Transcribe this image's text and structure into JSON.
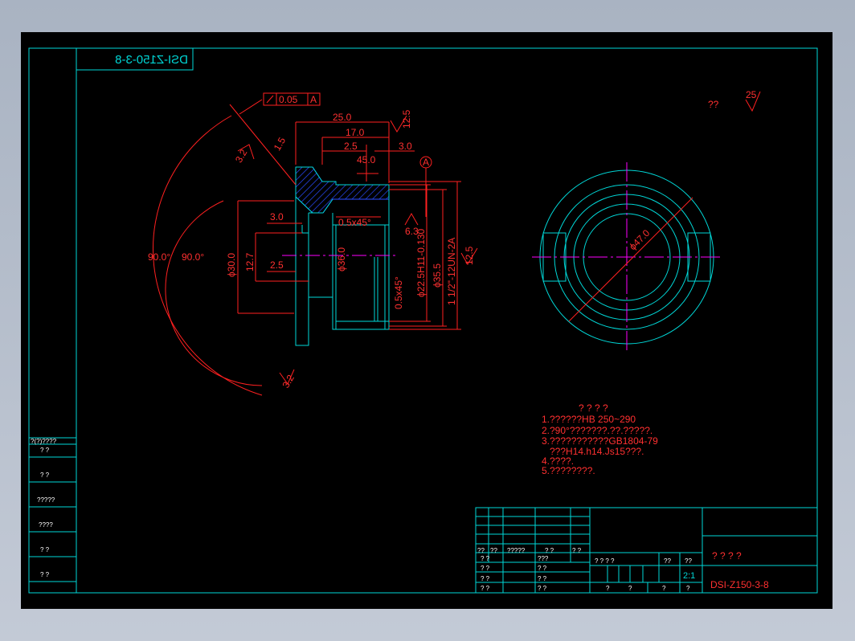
{
  "drawing": {
    "code_mirrored": "DSI-Z150-3-8",
    "code": "DSI-Z150-3-8",
    "scale": "2:1",
    "title_marks": "? ? ? ?",
    "roughness_note": "??",
    "roughness_value": "25"
  },
  "dimensions": {
    "tol_value": "0.05",
    "tol_datum": "A",
    "datum_label": "A",
    "d_25": "25.0",
    "d_17": "17.0",
    "d_2_5_top": "2.5",
    "d_3_0_top": "3.0",
    "d_45": "45.0",
    "d_1_5": "1.5",
    "d_3_0_left": "3.0",
    "d_2_5_left": "2.5",
    "d_12_7": "12.7",
    "d_phi30": "ϕ30.0",
    "d_phi36": "ϕ36.0",
    "d_chamfer1": "0.5x45°",
    "d_chamfer2": "0.5x45°",
    "d_bore": "ϕ22.5H11-0.130",
    "d_phi35_5": "ϕ35.5",
    "d_thread": "1 1/2\"-12UN-2A",
    "d_angle_left": "90.0°",
    "d_angle_right": "90.0°",
    "r_12_5_a": "12.5",
    "r_12_5_b": "12.5",
    "r_3_2_a": "3.2",
    "r_3_2_b": "3.2",
    "r_6_3": "6.3",
    "d_phi47": "ϕ47.0"
  },
  "notes": {
    "heading": "? ? ? ?",
    "lines": [
      "1.??????HB  250~290",
      "2.?90°???????.??.?????.",
      "3.???????????GB1804-79",
      "   ???H14.h14.Js15???.",
      "4.????.",
      "5.????????."
    ]
  },
  "left_table": {
    "rows": [
      "?(?)????",
      "?  ?",
      "?  ?",
      "?????",
      "????",
      "?  ?",
      "?  ?"
    ]
  },
  "title_block": {
    "header_row": [
      "??",
      "??",
      "?????",
      "?  ?",
      "?  ?"
    ],
    "sign_rows": [
      [
        "?  ?",
        "???"
      ],
      [
        "?  ?",
        "?  ?"
      ],
      [
        "?  ?",
        "?  ?"
      ],
      [
        "?  ?",
        "?  ?"
      ]
    ],
    "stage_row": [
      "?  ?  ?  ?",
      "??",
      "??"
    ],
    "bottom_row": [
      "?",
      "?",
      "?",
      "?"
    ]
  }
}
